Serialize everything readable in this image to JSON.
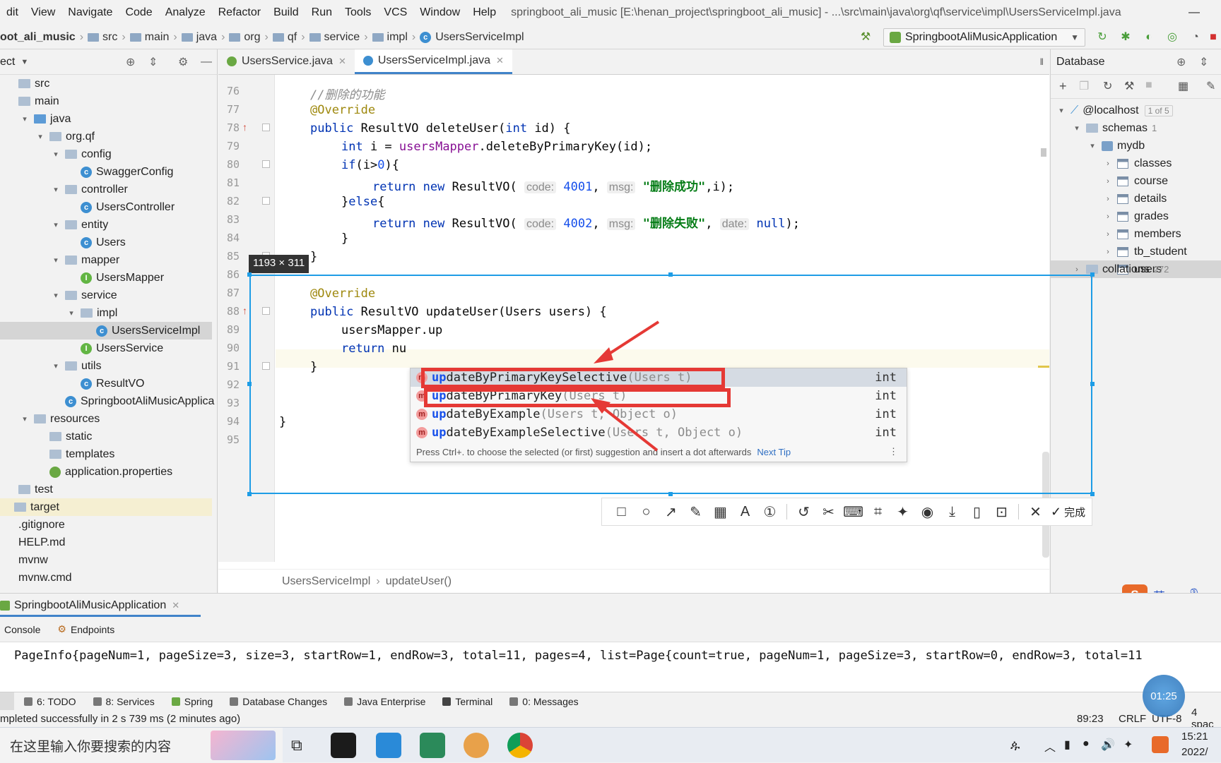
{
  "menu": {
    "items": [
      "dit",
      "View",
      "Navigate",
      "Code",
      "Analyze",
      "Refactor",
      "Build",
      "Run",
      "Tools",
      "VCS",
      "Window",
      "Help"
    ],
    "title": "springboot_ali_music [E:\\henan_project\\springboot_ali_music] - ...\\src\\main\\java\\org\\qf\\service\\impl\\UsersServiceImpl.java",
    "minimize": "—"
  },
  "nav": {
    "crumbs": [
      "oot_ali_music",
      "src",
      "main",
      "java",
      "org",
      "qf",
      "service",
      "impl",
      "UsersServiceImpl"
    ],
    "run_config": "SpringbootAliMusicApplication"
  },
  "project": {
    "header": "ect",
    "tree": [
      {
        "label": "src",
        "kind": "folder",
        "depth": 0,
        "arrow": ""
      },
      {
        "label": "main",
        "kind": "folder",
        "depth": 0,
        "arrow": ""
      },
      {
        "label": "java",
        "kind": "src",
        "depth": 1,
        "arrow": "▾"
      },
      {
        "label": "org.qf",
        "kind": "folder",
        "depth": 2,
        "arrow": "▾"
      },
      {
        "label": "config",
        "kind": "folder",
        "depth": 3,
        "arrow": "▾"
      },
      {
        "label": "SwaggerConfig",
        "kind": "class",
        "depth": 4,
        "arrow": ""
      },
      {
        "label": "controller",
        "kind": "folder",
        "depth": 3,
        "arrow": "▾"
      },
      {
        "label": "UsersController",
        "kind": "class",
        "depth": 4,
        "arrow": ""
      },
      {
        "label": "entity",
        "kind": "folder",
        "depth": 3,
        "arrow": "▾"
      },
      {
        "label": "Users",
        "kind": "class",
        "depth": 4,
        "arrow": ""
      },
      {
        "label": "mapper",
        "kind": "folder",
        "depth": 3,
        "arrow": "▾"
      },
      {
        "label": "UsersMapper",
        "kind": "interface",
        "depth": 4,
        "arrow": ""
      },
      {
        "label": "service",
        "kind": "folder",
        "depth": 3,
        "arrow": "▾"
      },
      {
        "label": "impl",
        "kind": "folder",
        "depth": 4,
        "arrow": "▾"
      },
      {
        "label": "UsersServiceImpl",
        "kind": "class",
        "depth": 5,
        "arrow": "",
        "selected": true
      },
      {
        "label": "UsersService",
        "kind": "interface",
        "depth": 4,
        "arrow": ""
      },
      {
        "label": "utils",
        "kind": "folder",
        "depth": 3,
        "arrow": "▾"
      },
      {
        "label": "ResultVO",
        "kind": "class",
        "depth": 4,
        "arrow": ""
      },
      {
        "label": "SpringbootAliMusicApplica",
        "kind": "class",
        "depth": 3,
        "arrow": ""
      },
      {
        "label": "resources",
        "kind": "folder",
        "depth": 1,
        "arrow": "▾"
      },
      {
        "label": "static",
        "kind": "folder",
        "depth": 2,
        "arrow": ""
      },
      {
        "label": "templates",
        "kind": "folder",
        "depth": 2,
        "arrow": ""
      },
      {
        "label": "application.properties",
        "kind": "file",
        "depth": 2,
        "arrow": ""
      },
      {
        "label": "test",
        "kind": "folder",
        "depth": 0,
        "arrow": ""
      },
      {
        "label": "target",
        "kind": "folder",
        "depth": 0,
        "arrow": "",
        "hl": true
      },
      {
        "label": ".gitignore",
        "kind": "plain",
        "depth": 0,
        "arrow": ""
      },
      {
        "label": "HELP.md",
        "kind": "plain",
        "depth": 0,
        "arrow": ""
      },
      {
        "label": "mvnw",
        "kind": "plain",
        "depth": 0,
        "arrow": ""
      },
      {
        "label": "mvnw.cmd",
        "kind": "plain",
        "depth": 0,
        "arrow": ""
      }
    ]
  },
  "editor": {
    "tabs": [
      {
        "label": "UsersService.java",
        "active": false
      },
      {
        "label": "UsersServiceImpl.java",
        "active": true
      }
    ],
    "line_numbers": [
      "76",
      "77",
      "78",
      "79",
      "80",
      "81",
      "82",
      "83",
      "84",
      "85",
      "86",
      "87",
      "88",
      "89",
      "90",
      "91",
      "92",
      "93",
      "94",
      "95"
    ],
    "breadcrumb": [
      "UsersServiceImpl",
      "updateUser()"
    ]
  },
  "code": {
    "l76": "//删除的功能",
    "override": "@Override",
    "l78a": "public ",
    "l78b": "ResultVO deleteUser(",
    "l78c": "int",
    "l78d": " id) {",
    "l79a": "int",
    "l79b": " i = ",
    "l79c": "usersMapper",
    "l79d": ".deleteByPrimaryKey(id);",
    "l80a": "if",
    "l80b": "(i>",
    "l80c": "0",
    "l80d": "){",
    "return": "return ",
    "new": "new ",
    "resultvo_open": "ResultVO( ",
    "hint_code": "code:",
    "hint_msg": "msg:",
    "hint_date": "date:",
    "n4001": "4001",
    "n4002": "4002",
    "s_ok": "\"删除成功\"",
    "s_fail": "\"删除失败\"",
    "l81end": ",i);",
    "l82a": "}",
    "l82b": "else",
    "l82c": "{",
    "null": "null",
    "l83end": ");",
    "close": "}",
    "l88a": "public ",
    "l88b": "ResultVO updateUser(Users users) {",
    "l89": "usersMapper.up",
    "l90a": "return ",
    "l90b": "nu"
  },
  "screenshot_overlay": {
    "size_label": "1193 × 311",
    "done_label": "完成"
  },
  "completion": {
    "items": [
      {
        "prefix": "up",
        "rest": "dateByPrimaryKeySelective",
        "params": "(Users t)",
        "type": "int"
      },
      {
        "prefix": "up",
        "rest": "dateByPrimaryKey",
        "params": "(Users t)",
        "type": "int"
      },
      {
        "prefix": "up",
        "rest": "dateByExample",
        "params": "(Users t, Object o)",
        "type": "int"
      },
      {
        "prefix": "up",
        "rest": "dateByExampleSelective",
        "params": "(Users t, Object o)",
        "type": "int"
      }
    ],
    "footer": "Press Ctrl+. to choose the selected (or first) suggestion and insert a dot afterwards",
    "next_tip": "Next Tip",
    "method_badge": "m"
  },
  "database": {
    "header": "Database",
    "host": "@localhost",
    "host_badge": "1 of 5",
    "schemas_label": "schemas",
    "schemas_count": "1",
    "db_name": "mydb",
    "tables": [
      "classes",
      "course",
      "details",
      "grades",
      "members",
      "tb_student",
      "users"
    ],
    "collations_label": "collations",
    "collations_count": "272"
  },
  "run": {
    "tab_label": "SpringbootAliMusicApplication",
    "console_tab": "Console",
    "endpoints_tab": "Endpoints",
    "output": "PageInfo{pageNum=1, pageSize=3, size=3, startRow=1, endRow=3, total=11, pages=4, list=Page{count=true, pageNum=1, pageSize=3, startRow=0, endRow=3, total=11"
  },
  "toolwindows": [
    {
      "label": "6: TODO"
    },
    {
      "label": "8: Services"
    },
    {
      "label": "Spring"
    },
    {
      "label": "Database Changes"
    },
    {
      "label": "Java Enterprise"
    },
    {
      "label": "Terminal"
    },
    {
      "label": "0: Messages"
    }
  ],
  "status": {
    "message": "mpleted successfully in 2 s 739 ms (2 minutes ago)",
    "position": "89:23",
    "line_sep": "CRLF",
    "encoding": "UTF-8",
    "indent": "4 spac"
  },
  "recording_timer": "01:25",
  "ime": {
    "lang": "英"
  },
  "taskbar": {
    "search_placeholder": "在这里输入你要搜索的内容",
    "time": "15:21",
    "date": "2022/"
  },
  "colors": {
    "accent": "#1e9de6",
    "annotation_red": "#e53935",
    "selection": "#d5dbe3"
  }
}
